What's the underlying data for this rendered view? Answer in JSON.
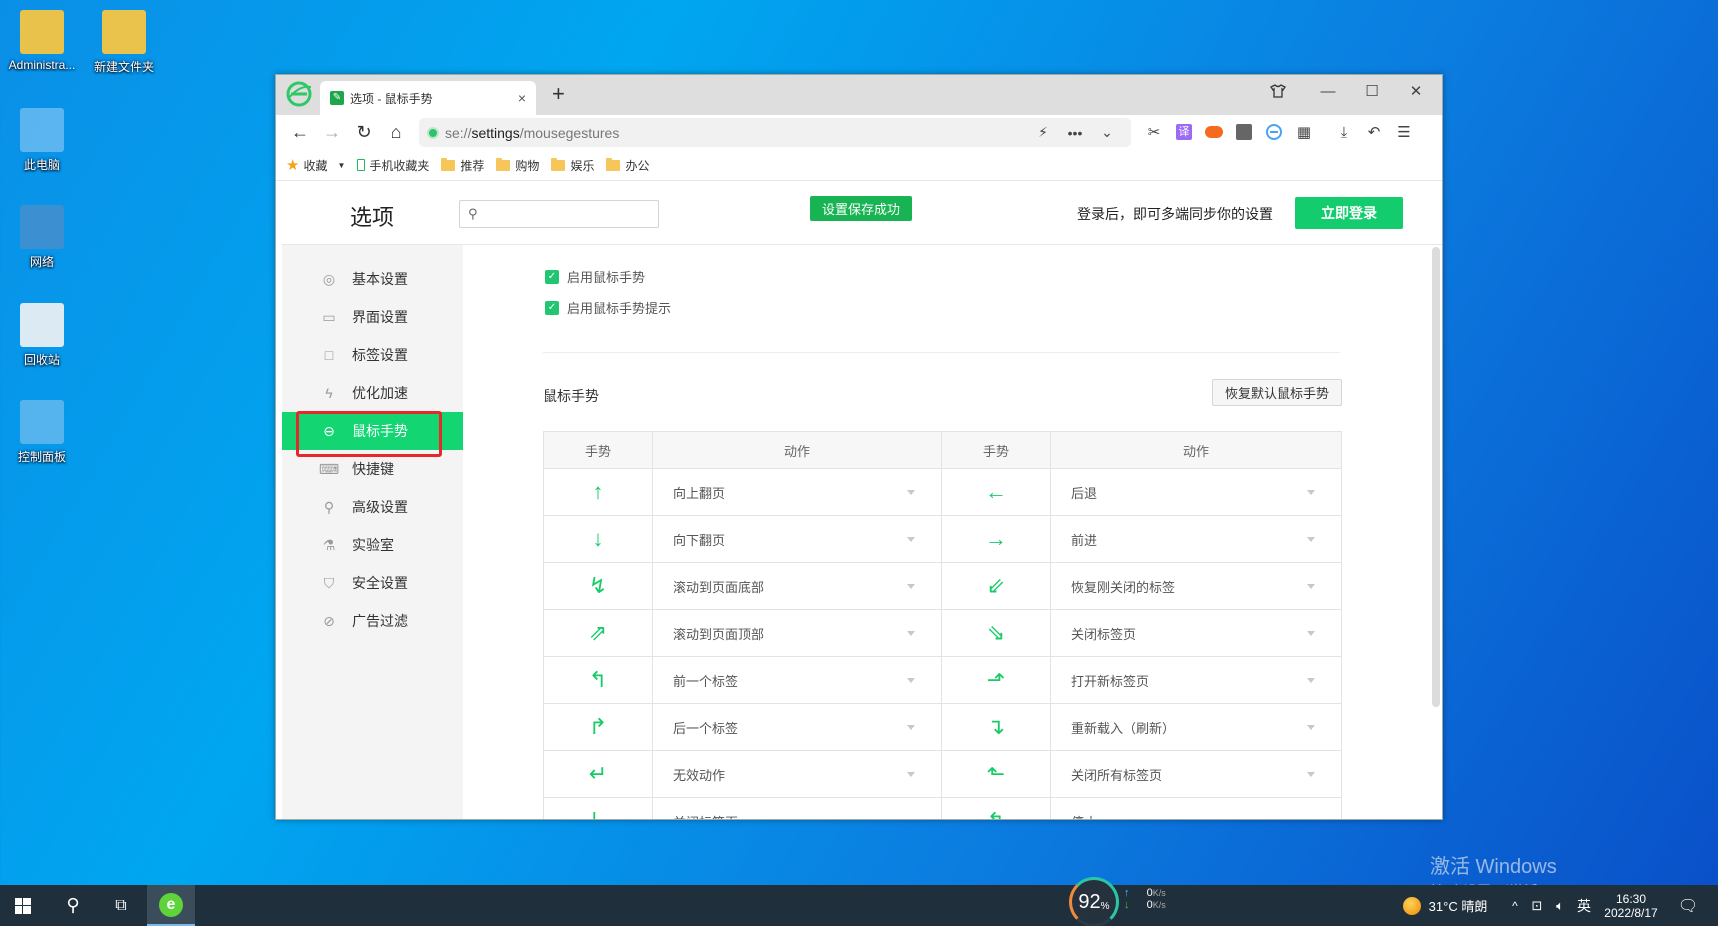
{
  "desktop": {
    "icons": [
      {
        "label": "Administra...",
        "icon": "user-folder-icon"
      },
      {
        "label": "新建文件夹",
        "icon": "folder-icon"
      },
      {
        "label": "此电脑",
        "icon": "computer-icon"
      },
      {
        "label": "网络",
        "icon": "network-icon"
      },
      {
        "label": "回收站",
        "icon": "recycle-bin-icon"
      },
      {
        "label": "控制面板",
        "icon": "control-panel-icon"
      }
    ],
    "watermark": {
      "line1": "激活 Windows",
      "line2": "转到\"设置\"以激活 Windows。"
    }
  },
  "browser": {
    "tab_title": "选项 - 鼠标手势",
    "tab_close": "×",
    "new_tab": "+",
    "url_scheme": "se://",
    "url_host": "settings",
    "url_path": "/mousegestures",
    "bookmarks": [
      {
        "label": "收藏",
        "icon": "star-icon"
      },
      {
        "label": "手机收藏夹",
        "icon": "phone-icon"
      },
      {
        "label": "推荐",
        "icon": "folder-icon"
      },
      {
        "label": "购物",
        "icon": "folder-icon"
      },
      {
        "label": "娱乐",
        "icon": "folder-icon"
      },
      {
        "label": "办公",
        "icon": "folder-icon"
      }
    ]
  },
  "settings": {
    "title": "选项",
    "search_placeholder": "",
    "save_message": "设置保存成功",
    "login_hint": "登录后，即可多端同步你的设置",
    "login_button": "立即登录",
    "sidebar": [
      {
        "label": "基本设置",
        "icon": "gear-icon",
        "glyph": "◎"
      },
      {
        "label": "界面设置",
        "icon": "window-icon",
        "glyph": "▭"
      },
      {
        "label": "标签设置",
        "icon": "tab-icon",
        "glyph": "□"
      },
      {
        "label": "优化加速",
        "icon": "lightning-icon",
        "glyph": "ϟ"
      },
      {
        "label": "鼠标手势",
        "icon": "mouse-icon",
        "glyph": "⊖",
        "active": true
      },
      {
        "label": "快捷键",
        "icon": "keyboard-icon",
        "glyph": "⌨"
      },
      {
        "label": "高级设置",
        "icon": "wrench-icon",
        "glyph": "⚲"
      },
      {
        "label": "实验室",
        "icon": "flask-icon",
        "glyph": "⚗"
      },
      {
        "label": "安全设置",
        "icon": "shield-icon",
        "glyph": "⛉"
      },
      {
        "label": "广告过滤",
        "icon": "block-icon",
        "glyph": "⊘"
      }
    ],
    "enable_gestures": {
      "label": "启用鼠标手势",
      "checked": true
    },
    "enable_hints": {
      "label": "启用鼠标手势提示",
      "checked": true
    },
    "gestures_title": "鼠标手势",
    "restore_button": "恢复默认鼠标手势",
    "table_headers": [
      "手势",
      "动作",
      "手势",
      "动作"
    ],
    "rows": [
      [
        {
          "gesture": "up-arrow-icon",
          "glyph": "↑",
          "action": "向上翻页"
        },
        {
          "gesture": "left-arrow-icon",
          "glyph": "←",
          "action": "后退"
        }
      ],
      [
        {
          "gesture": "down-arrow-icon",
          "glyph": "↓",
          "action": "向下翻页"
        },
        {
          "gesture": "right-arrow-icon",
          "glyph": "→",
          "action": "前进"
        }
      ],
      [
        {
          "gesture": "up-down-gesture-icon",
          "glyph": "↯",
          "action": "滚动到页面底部"
        },
        {
          "gesture": "left-right-zigzag-gesture-icon",
          "glyph": "⇙",
          "action": "恢复刚关闭的标签"
        }
      ],
      [
        {
          "gesture": "down-up-gesture-icon",
          "glyph": "⇗",
          "action": "滚动到页面顶部"
        },
        {
          "gesture": "right-left-zigzag-gesture-icon",
          "glyph": "⇘",
          "action": "关闭标签页"
        }
      ],
      [
        {
          "gesture": "down-left-gesture-icon",
          "glyph": "↰",
          "action": "前一个标签"
        },
        {
          "gesture": "right-up-gesture-icon",
          "glyph": "⬏",
          "action": "打开新标签页"
        }
      ],
      [
        {
          "gesture": "up-right-gesture-icon",
          "glyph": "↱",
          "action": "后一个标签"
        },
        {
          "gesture": "right-down-gesture-icon",
          "glyph": "↴",
          "action": "重新载入（刷新）"
        }
      ],
      [
        {
          "gesture": "down-left-gesture-icon",
          "glyph": "↵",
          "action": "无效动作"
        },
        {
          "gesture": "left-up-gesture-icon",
          "glyph": "⬑",
          "action": "关闭所有标签页"
        }
      ],
      [
        {
          "gesture": "down-right-gesture-icon",
          "glyph": "↳",
          "action": "关闭标签页"
        },
        {
          "gesture": "up-left-gesture-icon",
          "glyph": "↰",
          "action": "停止"
        }
      ]
    ]
  },
  "taskbar": {
    "memory_percent": "92",
    "percent_sign": "%",
    "upload": "0",
    "download": "0",
    "speed_unit": "K/s",
    "weather": "31°C  晴朗",
    "ime": "英",
    "time": "16:30",
    "date": "2022/8/17"
  }
}
